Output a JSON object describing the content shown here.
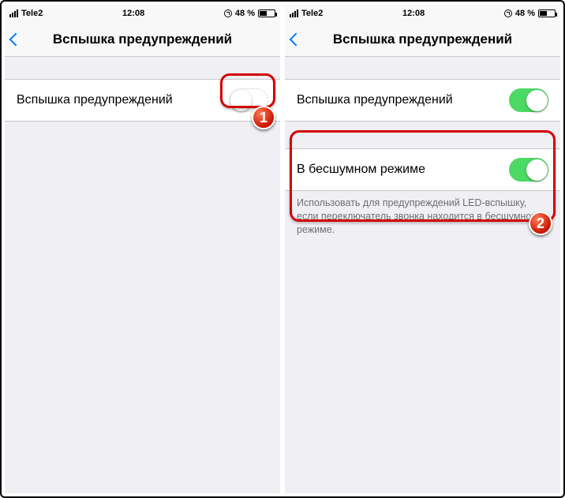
{
  "status": {
    "carrier": "Tele2",
    "time": "12:08",
    "battery_pct": "48 %"
  },
  "nav": {
    "title": "Вспышка предупреждений"
  },
  "left": {
    "row1_label": "Вспышка предупреждений",
    "row1_on": false
  },
  "right": {
    "row1_label": "Вспышка предупреждений",
    "row1_on": true,
    "row2_label": "В бесшумном режиме",
    "row2_on": true,
    "footer": "Использовать для предупреждений LED-вспышку, если переключатель звонка находится в бесшумном режиме."
  },
  "badges": {
    "b1": "1",
    "b2": "2"
  }
}
